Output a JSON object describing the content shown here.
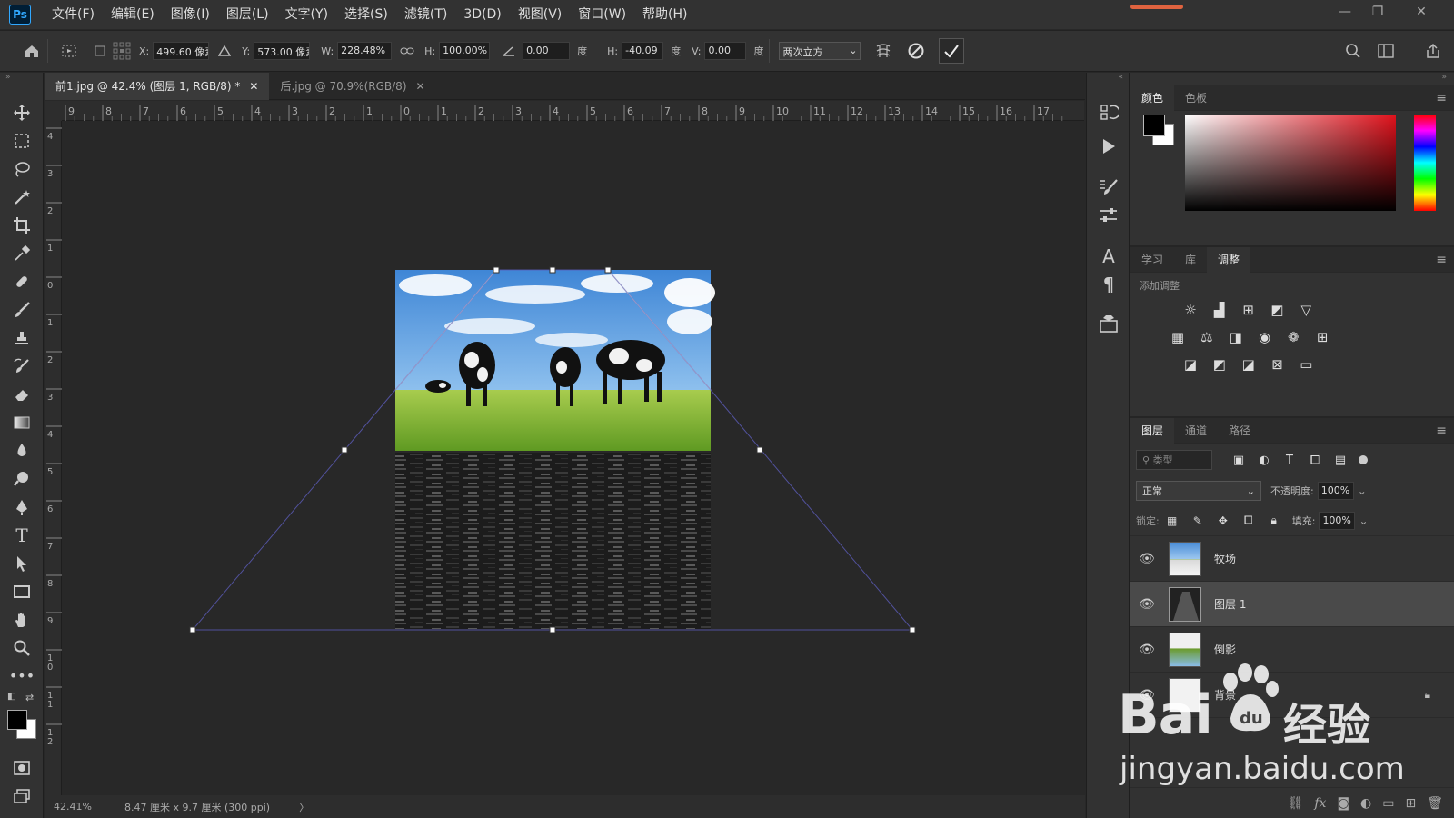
{
  "app": {
    "logo": "Ps"
  },
  "menu": [
    "文件(F)",
    "编辑(E)",
    "图像(I)",
    "图层(L)",
    "文字(Y)",
    "选择(S)",
    "滤镜(T)",
    "3D(D)",
    "视图(V)",
    "窗口(W)",
    "帮助(H)"
  ],
  "options": {
    "x_label": "X:",
    "x_value": "499.60 像素",
    "y_label": "Y:",
    "y_value": "573.00 像素",
    "w_label": "W:",
    "w_value": "228.48%",
    "h_label": "H:",
    "h_value": "100.00%",
    "angle_value": "0.00",
    "angle_unit": "度",
    "hskew_label": "H:",
    "hskew_value": "-40.09",
    "hskew_unit": "度",
    "vskew_label": "V:",
    "vskew_value": "0.00",
    "vskew_unit": "度",
    "interp": "两次立方"
  },
  "tabs": [
    {
      "label": "前1.jpg @ 42.4% (图层 1, RGB/8) *",
      "active": true
    },
    {
      "label": "后.jpg @ 70.9%(RGB/8)",
      "active": false
    }
  ],
  "ruler_h": [
    "9",
    "8",
    "7",
    "6",
    "5",
    "4",
    "3",
    "2",
    "1",
    "0",
    "1",
    "2",
    "3",
    "4",
    "5",
    "6",
    "7",
    "8",
    "9",
    "10",
    "11",
    "12",
    "13",
    "14",
    "15",
    "16",
    "17"
  ],
  "ruler_v": [
    "4",
    "3",
    "2",
    "1",
    "0",
    "1",
    "2",
    "3",
    "4",
    "5",
    "6",
    "7",
    "8",
    "9",
    "1 0",
    "1 1",
    "1 2"
  ],
  "status": {
    "zoom": "42.41%",
    "doc": "8.47 厘米 x 9.7 厘米 (300 ppi)",
    "arrow": "〉"
  },
  "color_panel": {
    "tabs": [
      "颜色",
      "色板"
    ]
  },
  "adjust_panel": {
    "tabs": [
      "学习",
      "库",
      "调整"
    ],
    "title": "添加调整"
  },
  "layers_panel": {
    "tabs": [
      "图层",
      "通道",
      "路径"
    ],
    "filter_placeholder": "类型",
    "blend_mode": "正常",
    "opacity_label": "不透明度:",
    "opacity_value": "100%",
    "lock_label": "锁定:",
    "fill_label": "填充:",
    "fill_value": "100%",
    "layers": [
      {
        "name": "牧场",
        "selected": false
      },
      {
        "name": "图层 1",
        "selected": true
      },
      {
        "name": "倒影",
        "selected": false
      },
      {
        "name": "背景",
        "selected": false,
        "locked": true
      }
    ]
  },
  "watermark": {
    "brand": "Bai",
    "paw": "du",
    "cn": "经验",
    "url": "jingyan.baidu.com"
  },
  "colors": {
    "accent": "#31a8ff",
    "bg": "#282828",
    "panel": "#323232"
  }
}
